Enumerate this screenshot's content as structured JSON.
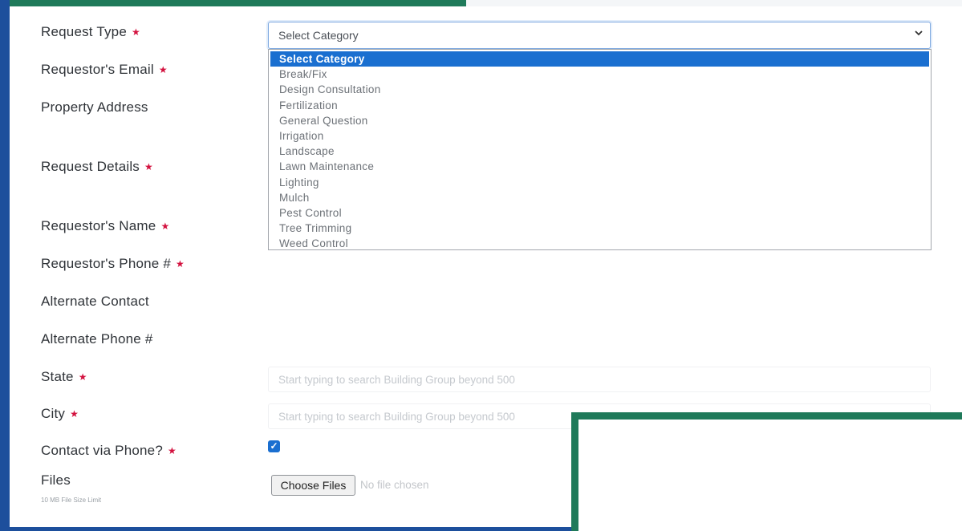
{
  "form": {
    "fields": [
      {
        "label": "Request Type",
        "required": true
      },
      {
        "label": "Requestor's Email",
        "required": true
      },
      {
        "label": "Property Address",
        "required": false
      },
      {
        "label": "Request Details",
        "required": true
      },
      {
        "label": "Requestor's Name",
        "required": true
      },
      {
        "label": "Requestor's Phone #",
        "required": true
      },
      {
        "label": "Alternate Contact",
        "required": false
      },
      {
        "label": "Alternate Phone #",
        "required": false
      },
      {
        "label": "State",
        "required": true
      },
      {
        "label": "City",
        "required": true
      },
      {
        "label": "Contact via Phone?",
        "required": true
      },
      {
        "label": "Files",
        "required": false
      }
    ],
    "required_marker": "★",
    "files_hint": "10 MB File Size Limit"
  },
  "request_type": {
    "value": "Select Category",
    "options": [
      "Select Category",
      "Break/Fix",
      "Design Consultation",
      "Fertilization",
      "General Question",
      "Irrigation",
      "Landscape",
      "Lawn Maintenance",
      "Lighting",
      "Mulch",
      "Pest Control",
      "Tree Trimming",
      "Weed Control"
    ],
    "selected_index": 0
  },
  "state_input": {
    "placeholder": "Start typing to search Building Group beyond 500"
  },
  "city_input": {
    "placeholder": "Start typing to search Building Group beyond 500"
  },
  "contact_via_phone": {
    "checked": true,
    "check_glyph": "✓"
  },
  "files": {
    "button_label": "Choose Files",
    "status": "No file chosen"
  },
  "icons": {
    "dropdown": "chevron-down-icon",
    "chevron_glyph": "⌄"
  },
  "colors": {
    "accent_blue": "#1a6fd0",
    "required_red": "#d3123f",
    "frame_green": "#1f7a5a",
    "frame_blue": "#1d4f9c"
  }
}
